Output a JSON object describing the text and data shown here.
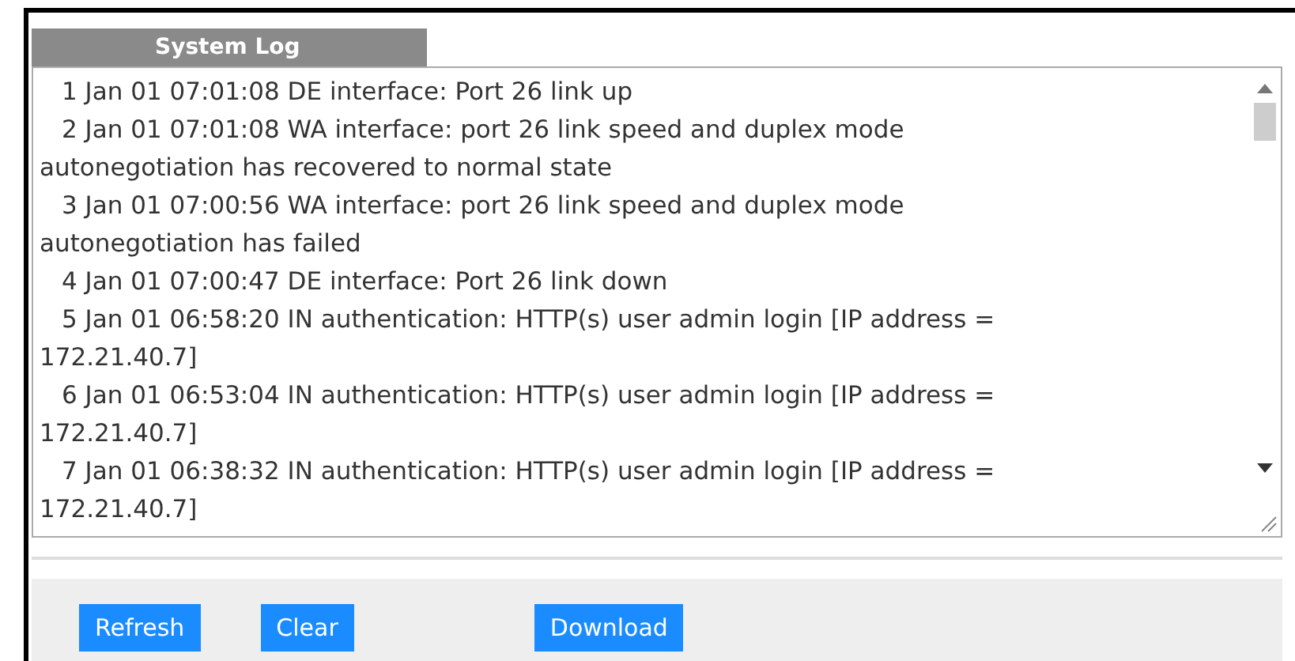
{
  "tab": {
    "label": "System Log",
    "selected": true
  },
  "log": [
    {
      "lines": [
        "1 Jan 01 07:01:08 DE interface: Port 26 link up"
      ]
    },
    {
      "lines": [
        "2 Jan 01 07:01:08 WA interface: port 26 link speed and duplex mode",
        "autonegotiation has recovered to normal state"
      ]
    },
    {
      "lines": [
        "3 Jan 01 07:00:56 WA interface: port 26 link speed and duplex mode",
        "autonegotiation has failed"
      ]
    },
    {
      "lines": [
        "4 Jan 01 07:00:47 DE interface: Port 26 link down"
      ]
    },
    {
      "lines": [
        "5 Jan 01 06:58:20 IN authentication: HTTP(s) user admin login [IP address =",
        "172.21.40.7]"
      ]
    },
    {
      "lines": [
        "6 Jan 01 06:53:04 IN authentication: HTTP(s) user admin login [IP address =",
        "172.21.40.7]"
      ]
    },
    {
      "lines": [
        "7 Jan 01 06:38:32 IN authentication: HTTP(s) user admin login [IP address =",
        "172.21.40.7]"
      ]
    }
  ],
  "buttons": [
    "Refresh",
    "Clear",
    "Download"
  ]
}
